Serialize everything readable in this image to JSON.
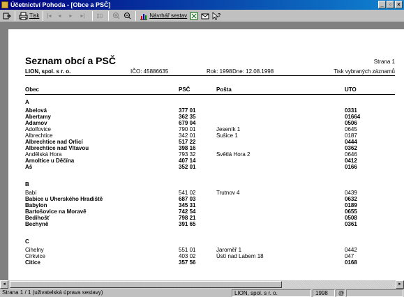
{
  "window": {
    "title": "Účetnictví Pohoda - [Obce a PSČ]",
    "buttons": [
      "_",
      "▫",
      "×"
    ]
  },
  "toolbar": {
    "print_label": "Tisk",
    "designer_label": "Návrhář sestav"
  },
  "report": {
    "title": "Seznam obcí a PSČ",
    "page_label": "Strana 1",
    "company": "LION, spol. s r. o.",
    "ico": "IČO: 45886635",
    "rok": "Rok: 1998",
    "dne": "Dne: 12.08.1998",
    "tisk": "Tisk vybraných záznamů",
    "headers": {
      "obec": "Obec",
      "psc": "PSČ",
      "posta": "Pošta",
      "uto": "UTO"
    },
    "sections": [
      {
        "letter": "A",
        "rows": [
          {
            "obec": "Abelová",
            "psc": "377 01",
            "posta": "",
            "uto": "0331",
            "bold": true
          },
          {
            "obec": "Abertamy",
            "psc": "362 35",
            "posta": "",
            "uto": "01664",
            "bold": true
          },
          {
            "obec": "Adamov",
            "psc": "679 04",
            "posta": "",
            "uto": "0506",
            "bold": true
          },
          {
            "obec": "Adolfovice",
            "psc": "790 01",
            "posta": "Jeseník 1",
            "uto": "0645",
            "bold": false
          },
          {
            "obec": "Albrechtice",
            "psc": "342 01",
            "posta": "Sušice 1",
            "uto": "0187",
            "bold": false
          },
          {
            "obec": "Albrechtice nad Orlicí",
            "psc": "517 22",
            "posta": "",
            "uto": "0444",
            "bold": true
          },
          {
            "obec": "Albrechtice nad Vltavou",
            "psc": "398 16",
            "posta": "",
            "uto": "0362",
            "bold": true
          },
          {
            "obec": "Andělská Hora",
            "psc": "793 32",
            "posta": "Světlá Hora 2",
            "uto": "0646",
            "bold": false
          },
          {
            "obec": "Arnoltice u Děčína",
            "psc": "407 14",
            "posta": "",
            "uto": "0412",
            "bold": true
          },
          {
            "obec": "Aš",
            "psc": "352 01",
            "posta": "",
            "uto": "0166",
            "bold": true
          }
        ]
      },
      {
        "letter": "B",
        "rows": [
          {
            "obec": "Babí",
            "psc": "541 02",
            "posta": "Trutnov 4",
            "uto": "0439",
            "bold": false
          },
          {
            "obec": "Babice u Uherského Hradiště",
            "psc": "687 03",
            "posta": "",
            "uto": "0632",
            "bold": true
          },
          {
            "obec": "Babylon",
            "psc": "345 31",
            "posta": "",
            "uto": "0189",
            "bold": true
          },
          {
            "obec": "Bartošovice na Moravě",
            "psc": "742 54",
            "posta": "",
            "uto": "0655",
            "bold": true
          },
          {
            "obec": "Bedihošť",
            "psc": "798 21",
            "posta": "",
            "uto": "0508",
            "bold": true
          },
          {
            "obec": "Bechyně",
            "psc": "391 65",
            "posta": "",
            "uto": "0361",
            "bold": true
          }
        ]
      },
      {
        "letter": "C",
        "rows": [
          {
            "obec": "Cihelny",
            "psc": "551 01",
            "posta": "Jaroměř 1",
            "uto": "0442",
            "bold": false
          },
          {
            "obec": "Církvice",
            "psc": "403 02",
            "posta": "Ústí nad Labem 18",
            "uto": "047",
            "bold": false
          },
          {
            "obec": "Citice",
            "psc": "357 56",
            "posta": "",
            "uto": "0168",
            "bold": true
          }
        ]
      }
    ]
  },
  "status": {
    "page_info": "Strana 1 / 1  (uživatelská úprava sestavy)",
    "company": "LION, spol. s r. o.",
    "year": "1998",
    "indicator": "@"
  }
}
